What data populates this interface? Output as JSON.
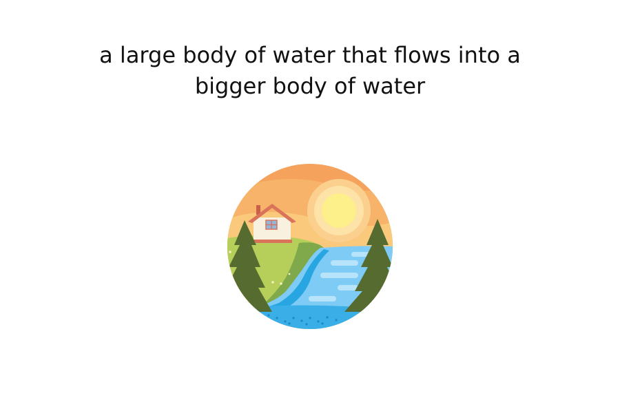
{
  "caption": {
    "text": "a large body of water that flows into a bigger body of water"
  },
  "illustration": {
    "subject": "river-landscape-icon",
    "colors": {
      "sky_far": "#f5a25d",
      "sky_mid": "#f7b36a",
      "sky_near": "#fbc97c",
      "sun_halo": "#fde3a7",
      "sun": "#fdf08b",
      "grass": "#b5cf5a",
      "grass_dark": "#7fa94a",
      "tree": "#556b2f",
      "water": "#7ecbf5",
      "water_dark": "#27a6e1",
      "water_light": "#b8e4fb",
      "house_wall": "#f8f1df",
      "roof": "#d9735a",
      "window": "#8fb8e0"
    }
  }
}
